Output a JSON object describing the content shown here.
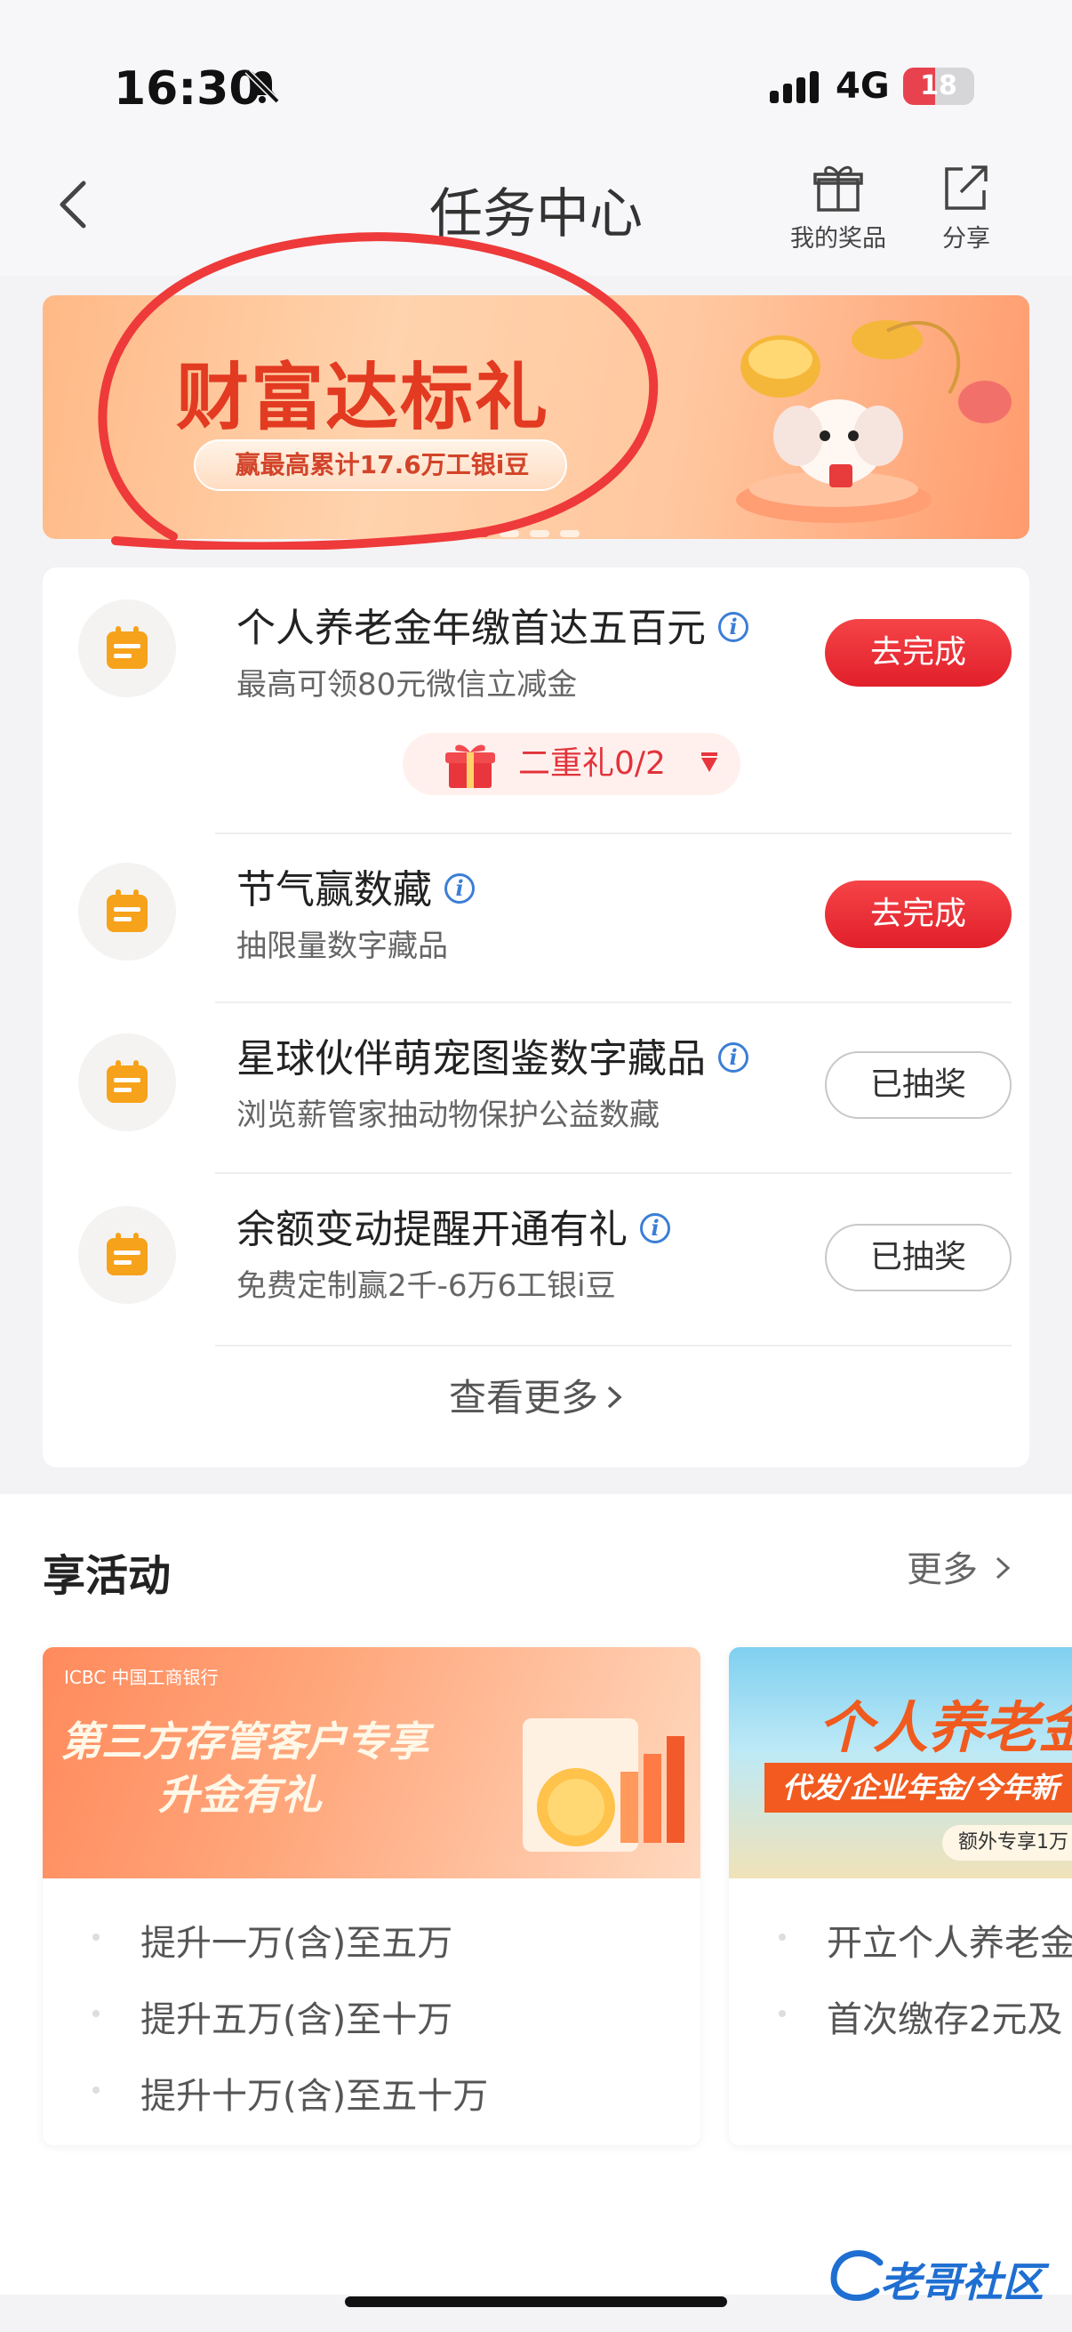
{
  "status_bar": {
    "time": "16:30",
    "network": "4G",
    "battery": "18",
    "battery_level": 0.18
  },
  "nav": {
    "title": "任务中心",
    "prize_label": "我的奖品",
    "share_label": "分享"
  },
  "banner": {
    "title": "财富达标礼",
    "subtitle": "赢最高累计17.6万工银i豆",
    "slide_count": 4,
    "active_slide": 0
  },
  "tasks": [
    {
      "title": "个人养老金年缴首达五百元",
      "subtitle": "最高可领80元微信立减金",
      "action": "去完成",
      "status": "pending"
    },
    {
      "title": "节气赢数藏",
      "subtitle": "抽限量数字藏品",
      "action": "去完成",
      "status": "pending"
    },
    {
      "title": "星球伙伴萌宠图鉴数字藏品",
      "subtitle": "浏览薪管家抽动物保护公益数藏",
      "action": "已抽奖",
      "status": "done"
    },
    {
      "title": "余额变动提醒开通有礼",
      "subtitle": "免费定制赢2千-6万6工银i豆",
      "action": "已抽奖",
      "status": "done"
    }
  ],
  "double_gift": {
    "label": "二重礼0/2"
  },
  "view_more": "查看更多",
  "activities": {
    "title": "享活动",
    "more": "更多",
    "cards": [
      {
        "bank": "ICBC 中国工商银行",
        "headline1": "第三方存管客户专享",
        "headline2": "升金有礼",
        "bullets": [
          "提升一万(含)至五万",
          "提升五万(含)至十万",
          "提升十万(含)至五十万"
        ]
      },
      {
        "headline1": "个人养老金",
        "headline2": "代发/企业年金/今年新",
        "tag": "额外专享1万",
        "bullets": [
          "开立个人养老金",
          "首次缴存2元及"
        ]
      }
    ]
  },
  "watermark": "老哥社区",
  "colors": {
    "accent_red": "#e11f2a",
    "info_blue": "#3b7ed6",
    "task_icon_orange": "#f7a21b"
  }
}
